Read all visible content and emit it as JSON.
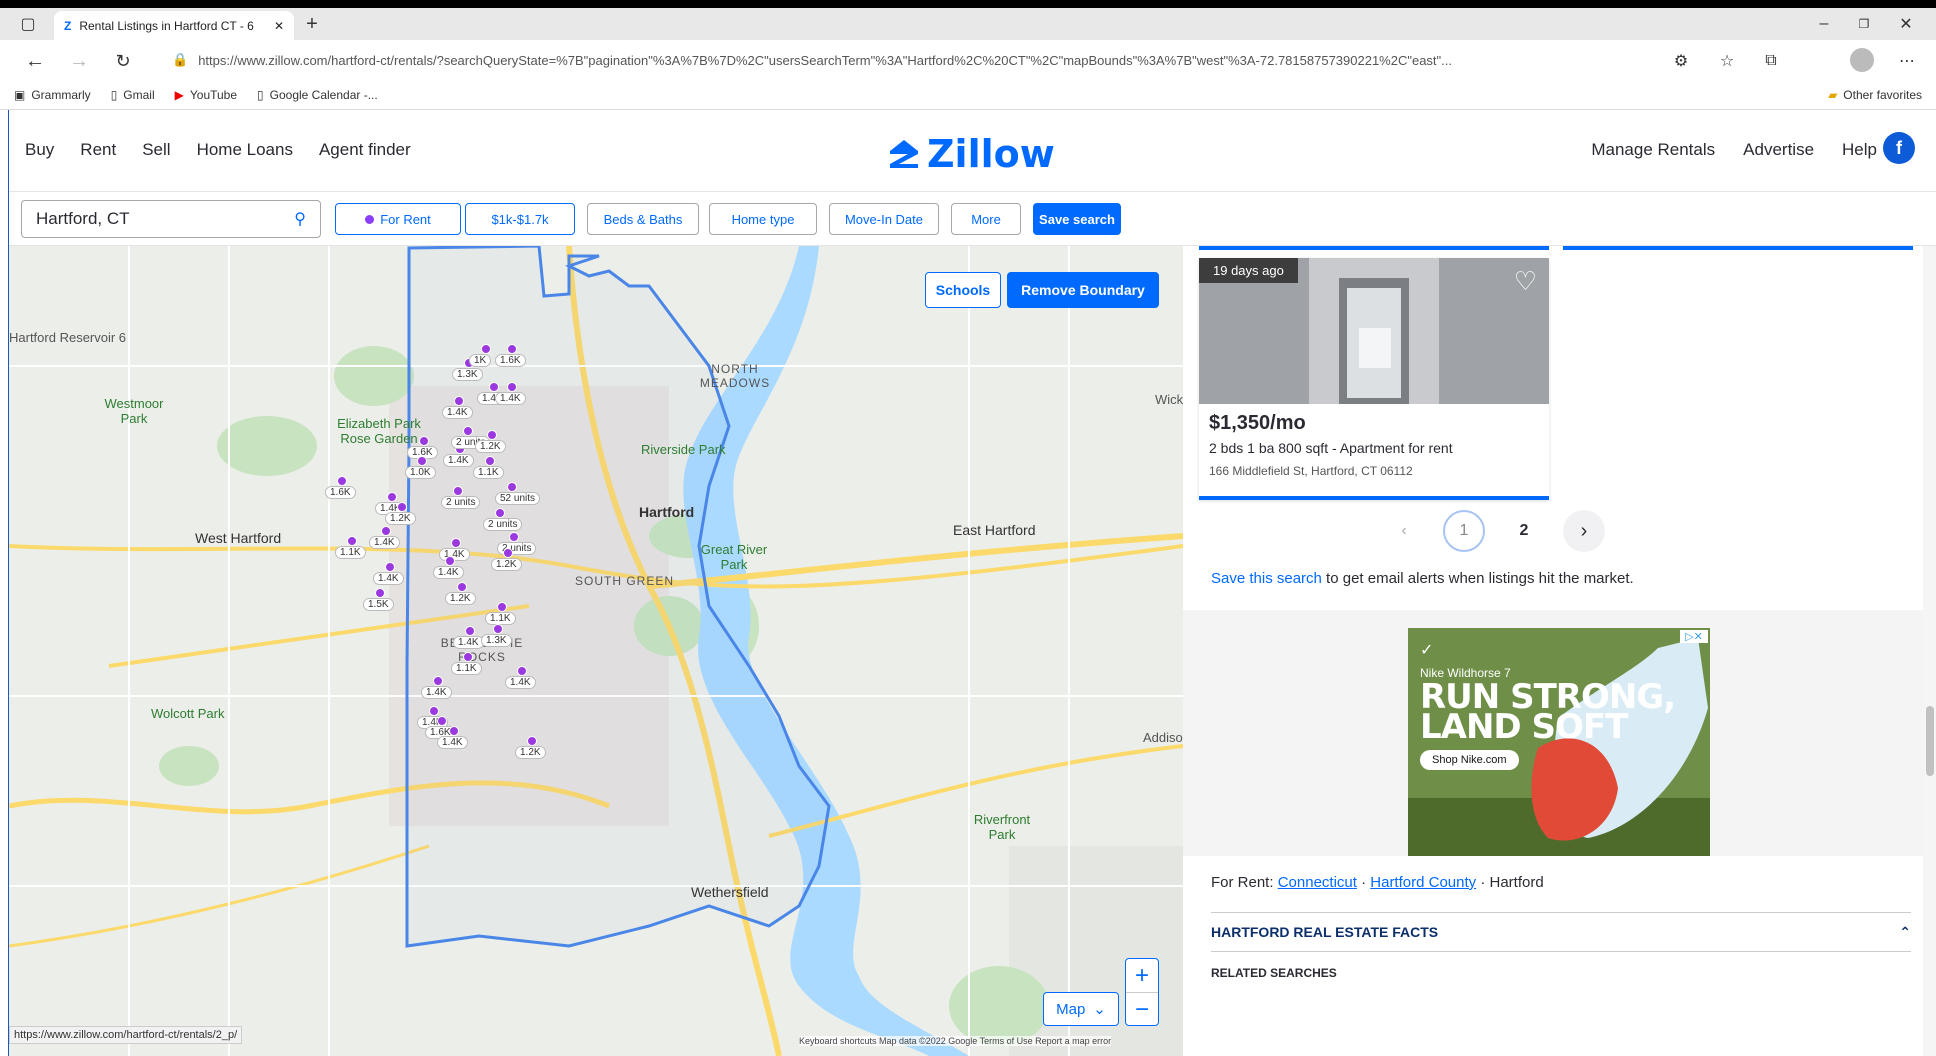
{
  "browser": {
    "tab_title": "Rental Listings in Hartford CT - 6",
    "url": "https://www.zillow.com/hartford-ct/rentals/?searchQueryState=%7B\"pagination\"%3A%7B%7D%2C\"usersSearchTerm\"%3A\"Hartford%2C%20CT\"%2C\"mapBounds\"%3A%7B\"west\"%3A-72.78158757390221%2C\"east\"...",
    "bookmarks": [
      "Grammarly",
      "Gmail",
      "YouTube",
      "Google Calendar -..."
    ],
    "other_favorites": "Other favorites"
  },
  "nav": {
    "left": [
      "Buy",
      "Rent",
      "Sell",
      "Home Loans",
      "Agent finder"
    ],
    "logo": "Zillow",
    "right": [
      "Manage Rentals",
      "Advertise",
      "Help"
    ],
    "avatar_initial": "f"
  },
  "filters": {
    "search_value": "Hartford, CT",
    "for_rent": "For Rent",
    "price": "$1k-$1.7k",
    "beds_baths": "Beds & Baths",
    "home_type": "Home type",
    "move_in": "Move-In Date",
    "more": "More",
    "save_search": "Save search"
  },
  "map": {
    "schools": "Schools",
    "remove_boundary": "Remove Boundary",
    "map_type": "Map",
    "attribution": "Keyboard shortcuts   Map data ©2022 Google   Terms of Use   Report a map error",
    "status_url": "https://www.zillow.com/hartford-ct/rentals/2_p/",
    "place_labels": [
      "Hartford Reservoir 6",
      "Westmoor Park",
      "Elizabeth Park Rose Garden",
      "NORTH MEADOWS",
      "Riverside Park",
      "West Hartford",
      "East Hartford",
      "Great River Park",
      "SOUTH GREEN",
      "BEHIND THE ROCKS",
      "Wolcott Park",
      "Riverfront Park",
      "Wethersfield",
      "Hartford",
      "Addiso",
      "Wick"
    ],
    "price_labels": [
      "1.3K",
      "1K",
      "1.6K",
      "1.4K",
      "1.4K",
      "1.4K",
      "1.6K",
      "1.4K",
      "2 units",
      "1.2K",
      "1.1K",
      "1.6K",
      "1.4K",
      "1.0K",
      "2 units",
      "52 units",
      "1.4K",
      "1.2K",
      "2 units",
      "2 units",
      "1.4K",
      "1.4K",
      "1.2K",
      "1.1K",
      "1.4K",
      "1.5K",
      "1.2K",
      "1.1K",
      "1.4K",
      "1.3K",
      "1.1K",
      "1.4K",
      "1.4K",
      "1.4K",
      "1.6K",
      "1.4K",
      "1.2K"
    ]
  },
  "listing": {
    "badge": "19 days ago",
    "price": "$1,350/mo",
    "details": "2 bds  1 ba  800 sqft  - Apartment for rent",
    "address": "166 Middlefield St, Hartford, CT 06112"
  },
  "pager": {
    "current": "1",
    "next_page": "2"
  },
  "save_text": {
    "link": "Save this search",
    "rest": " to get email alerts when listings hit the market."
  },
  "ad": {
    "product": "Nike Wildhorse 7",
    "headline1": "RUN STRONG,",
    "headline2": "LAND SOFT",
    "cta": "Shop Nike.com"
  },
  "footer": {
    "for_rent_label": "For Rent:",
    "crumb1": "Connecticut",
    "crumb2": "Hartford County",
    "crumb3": "Hartford",
    "facts_title": "HARTFORD REAL ESTATE FACTS",
    "related": "RELATED SEARCHES"
  }
}
